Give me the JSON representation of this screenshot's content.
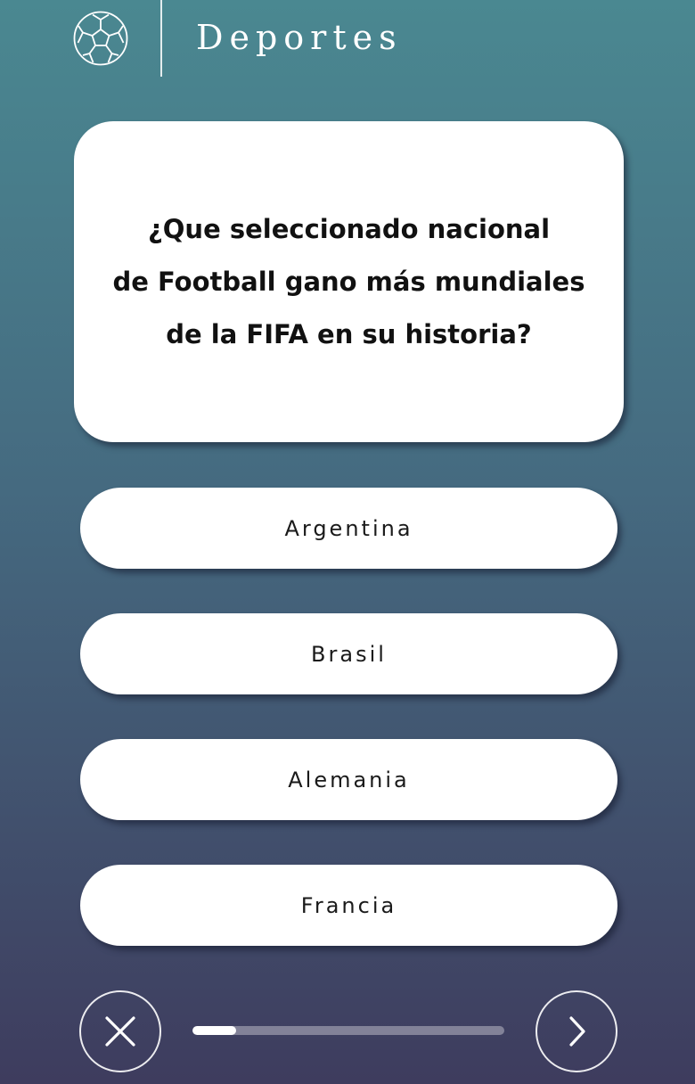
{
  "header": {
    "category": "Deportes",
    "icon": "soccer-ball-icon"
  },
  "question": {
    "lines": [
      "¿Que seleccionado nacional",
      "de Football gano más mundiales",
      "de la FIFA en su historia?"
    ]
  },
  "answers": [
    {
      "label": "Argentina"
    },
    {
      "label": "Brasil"
    },
    {
      "label": "Alemania"
    },
    {
      "label": "Francia"
    }
  ],
  "footer": {
    "close_icon": "close-icon",
    "next_icon": "chevron-right-icon",
    "progress_fraction": 0.14
  },
  "colors": {
    "background_top": "#4a8891",
    "background_bottom": "#3e3c5e",
    "card": "#ffffff"
  }
}
